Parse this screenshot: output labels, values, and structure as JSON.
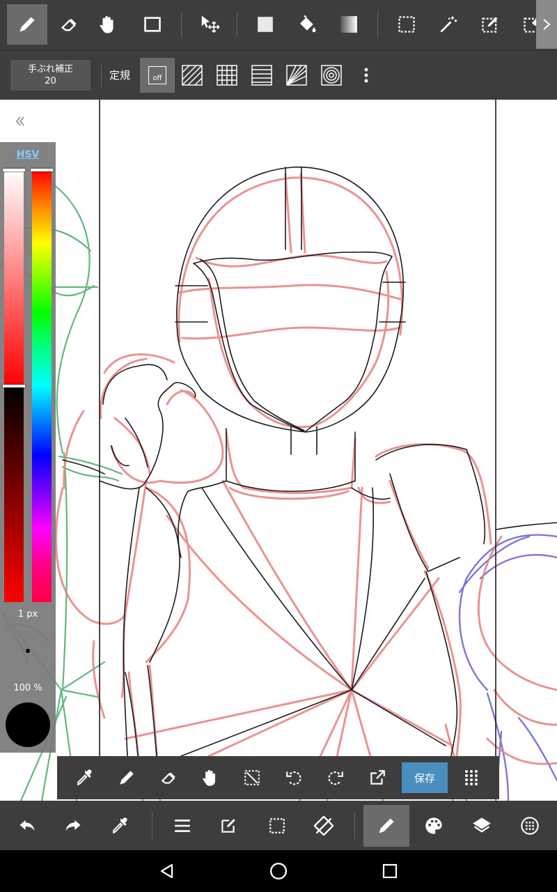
{
  "top_toolbar": {
    "tools": [
      {
        "name": "pen-tool",
        "icon": "pen-icon",
        "active": true
      },
      {
        "name": "eraser-tool",
        "icon": "eraser-icon"
      },
      {
        "name": "hand-tool",
        "icon": "hand-icon"
      },
      {
        "name": "shape-tool",
        "icon": "rectangle-icon"
      },
      {
        "name": "move-tool",
        "icon": "move-icon"
      },
      {
        "name": "fill-rect-tool",
        "icon": "filled-square-icon"
      },
      {
        "name": "bucket-tool",
        "icon": "paint-bucket-icon"
      },
      {
        "name": "gradient-tool",
        "icon": "gradient-icon"
      },
      {
        "name": "select-tool",
        "icon": "dotted-rect-icon"
      },
      {
        "name": "magic-wand-tool",
        "icon": "magic-wand-icon"
      },
      {
        "name": "select-pen-tool",
        "icon": "select-pen-icon"
      },
      {
        "name": "select-eraser-tool",
        "icon": "select-eraser-icon"
      }
    ],
    "more_icon": "chevron-right-icon"
  },
  "sub_toolbar": {
    "stabilizer_label": "手ぶれ補正",
    "stabilizer_value": "20",
    "ruler_label": "定規",
    "off_label": "off",
    "ruler_options": [
      "off-icon",
      "parallel-lines-icon",
      "grid-icon",
      "horizontal-lines-icon",
      "radial-icon",
      "concentric-icon"
    ],
    "more_icon": "vertical-ellipsis-icon"
  },
  "color_panel": {
    "mode_tab": "HSV",
    "brush_size": "1 px",
    "opacity": "100 %",
    "current_color": "#000000",
    "collapse_icon": "double-chevron-left-icon"
  },
  "float_toolbar": {
    "tools": [
      "eyedropper-icon",
      "pen-icon",
      "eraser-icon",
      "hand-icon",
      "clear-selection-icon",
      "rotate-left-icon",
      "rotate-right-icon",
      "export-icon"
    ],
    "save_label": "保存",
    "grid_icon": "dots-grid-icon"
  },
  "bottom_bar": {
    "items": [
      "undo-icon",
      "redo-icon",
      "eyedropper-icon",
      "menu-icon",
      "edit-icon",
      "selection-icon",
      "transform-icon",
      "brush-icon",
      "palette-icon",
      "layers-icon",
      "settings-icon"
    ],
    "active": "brush-icon"
  },
  "nav_bar": {
    "items": [
      "back-icon",
      "home-icon",
      "recents-icon"
    ]
  },
  "colors": {
    "toolbar_bg": "#3d3d3d",
    "active_bg": "#6b6b6b",
    "accent": "#4a8ec0",
    "sketch_red": "#e88080",
    "sketch_green": "#50b070",
    "sketch_blue": "#6a6ad8"
  }
}
